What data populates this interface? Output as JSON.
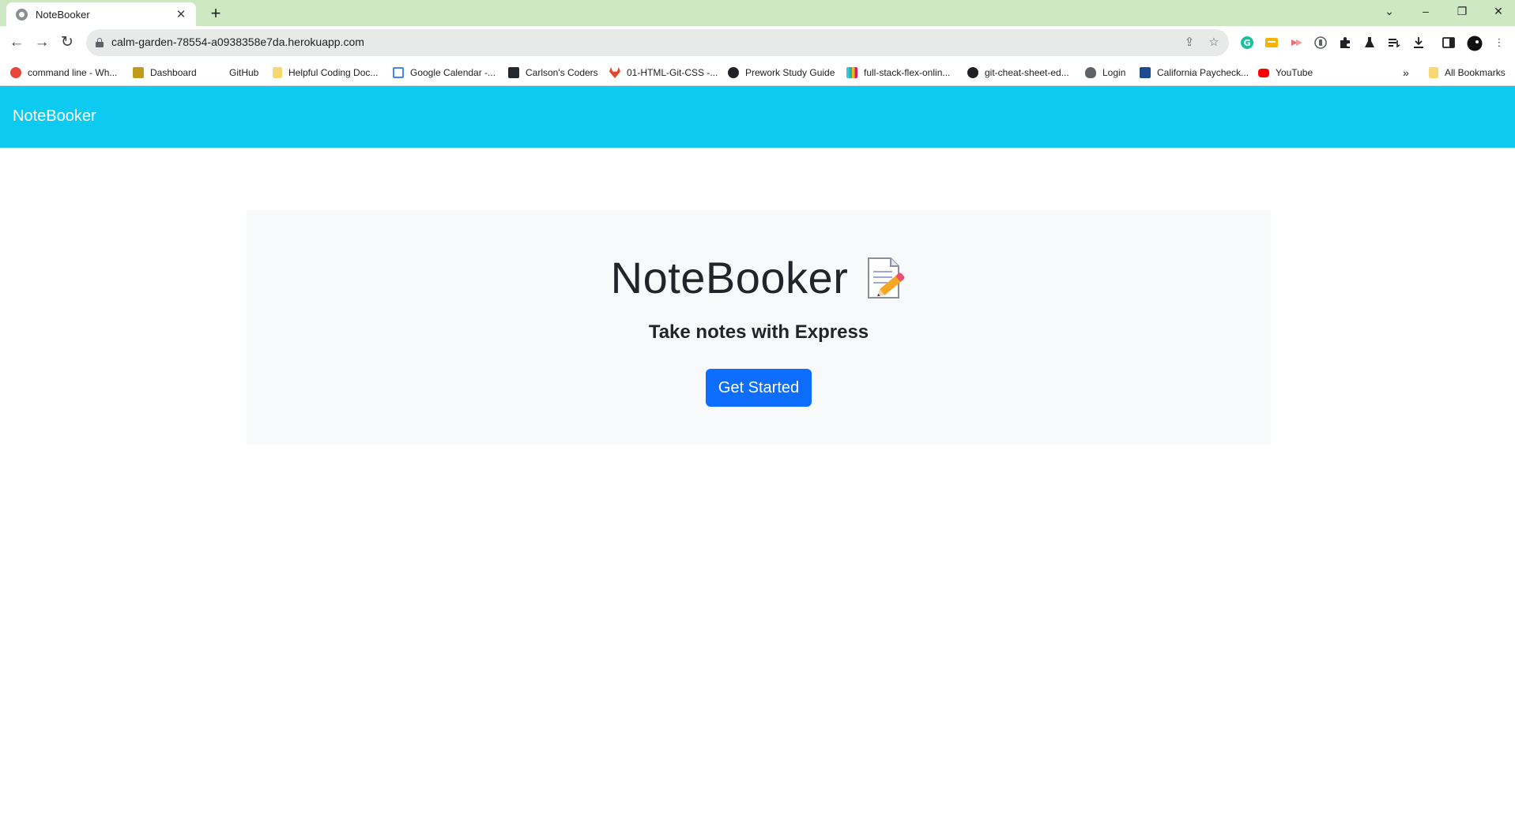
{
  "browser": {
    "tab": {
      "title": "NoteBooker",
      "favicon": "globe-icon"
    },
    "new_tab_label": "+",
    "url": "calm-garden-78554-a0938358e7da.herokuapp.com",
    "window_controls": [
      "chevron-down-icon",
      "minimize-icon",
      "restore-icon",
      "close-icon"
    ]
  },
  "bookmarks": {
    "items": [
      {
        "label": "command line - Wh...",
        "icon": "ask-icon",
        "color": "#e8453c"
      },
      {
        "label": "Dashboard",
        "icon": "dashboard-icon",
        "color": "#c19a1b"
      },
      {
        "label": "GitHub",
        "icon": "none"
      },
      {
        "label": "Helpful Coding Doc...",
        "icon": "folder-icon",
        "color": "#f7d774"
      },
      {
        "label": "Google Calendar -...",
        "icon": "calendar-icon",
        "color": "#4285f4"
      },
      {
        "label": "Carlson's Coders",
        "icon": "code-icon",
        "color": "#24292f"
      },
      {
        "label": "01-HTML-Git-CSS -...",
        "icon": "gitlab-icon",
        "color": "#e24329"
      },
      {
        "label": "Prework Study Guide",
        "icon": "globe-icon",
        "color": "#202124"
      },
      {
        "label": "full-stack-flex-onlin...",
        "icon": "slack-icon",
        "color": "#e01e5a"
      },
      {
        "label": "git-cheat-sheet-ed...",
        "icon": "github-icon",
        "color": "#202124"
      },
      {
        "label": "Login",
        "icon": "paw-icon",
        "color": "#5f6368"
      },
      {
        "label": "California Paycheck...",
        "icon": "smartasset-icon",
        "color": "#1d4b8f"
      },
      {
        "label": "YouTube",
        "icon": "youtube-icon",
        "color": "#ff0000"
      }
    ],
    "overflow_label": "»",
    "all_bookmarks_label": "All Bookmarks"
  },
  "navbar": {
    "brand": "NoteBooker",
    "color": "#0dcaf0"
  },
  "hero": {
    "title": "NoteBooker",
    "emoji": "memo-icon",
    "subtitle": "Take notes with Express",
    "button_label": "Get Started",
    "button_color": "#0d6efd"
  }
}
